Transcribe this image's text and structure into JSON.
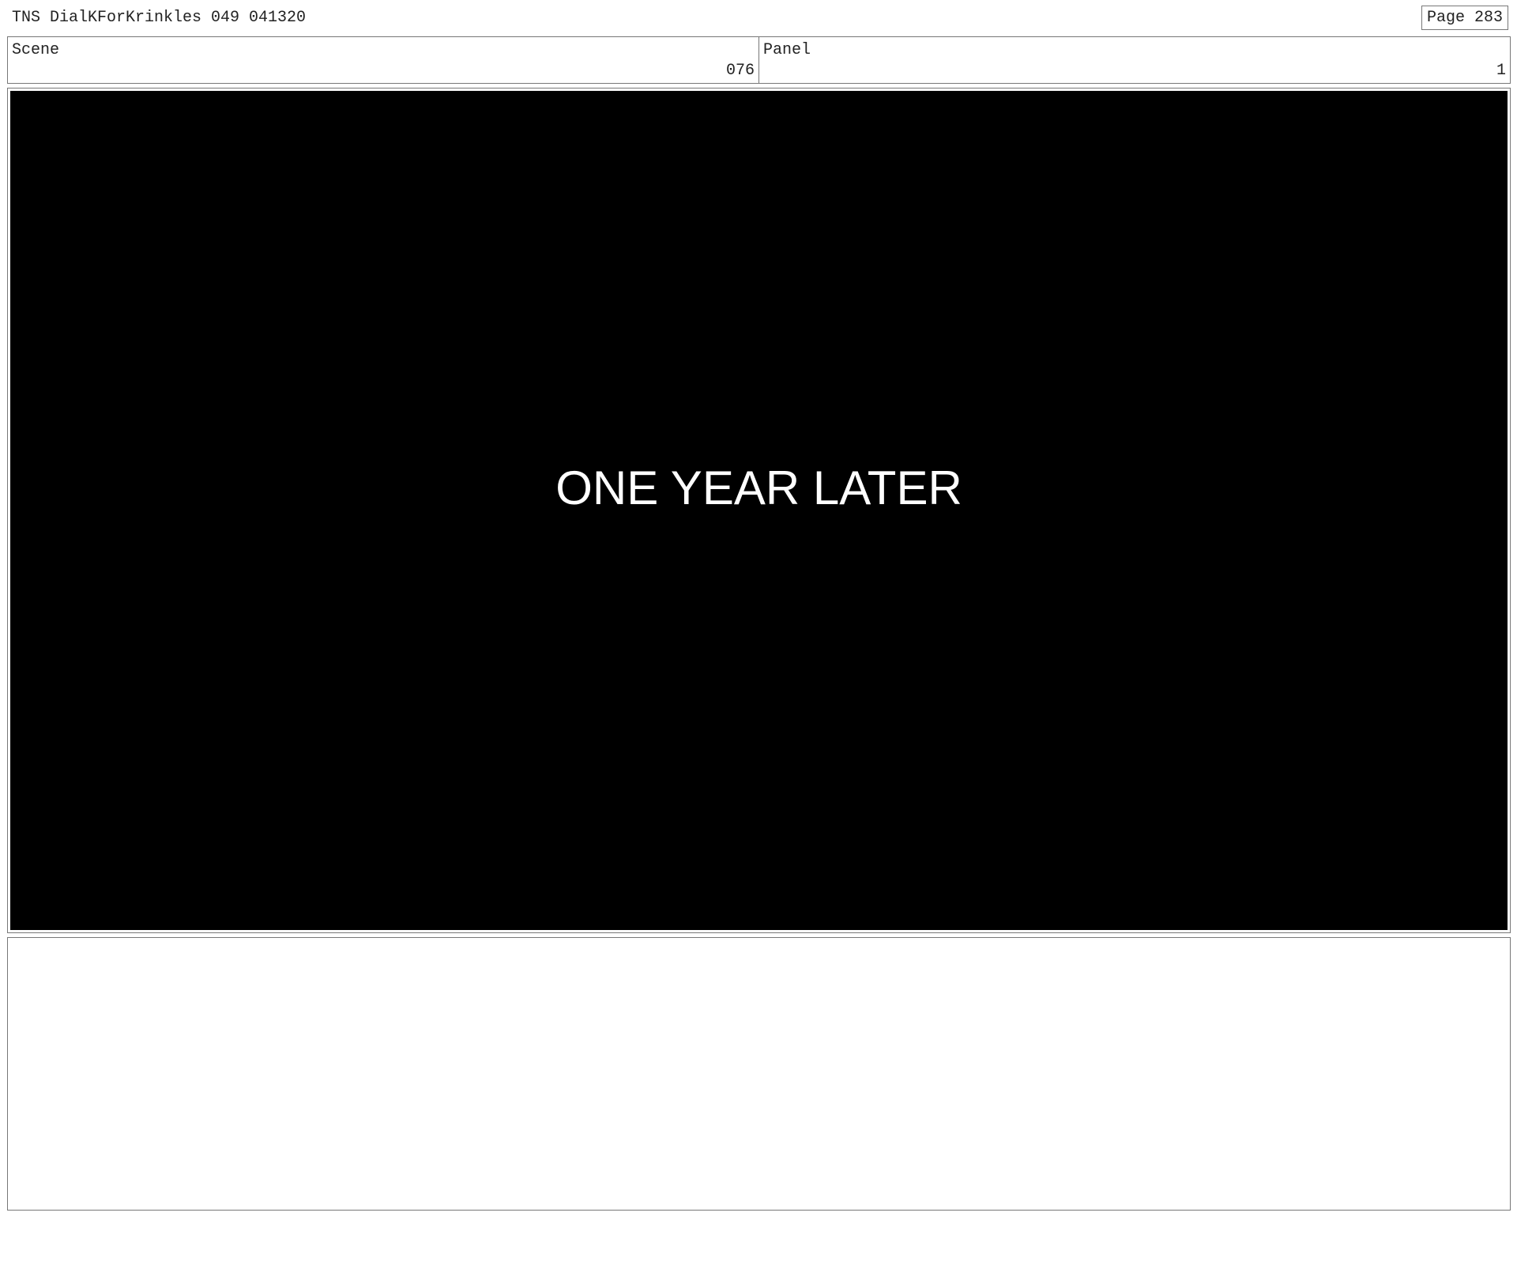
{
  "header": {
    "title": "TNS DialKForKrinkles 049 041320",
    "page_label": "Page 283"
  },
  "info": {
    "scene_label": "Scene",
    "scene_value": "076",
    "panel_label": "Panel",
    "panel_value": "1"
  },
  "frame": {
    "caption": "ONE YEAR LATER",
    "background_color": "#000000",
    "caption_color": "#ffffff"
  },
  "notes": {
    "text": ""
  }
}
